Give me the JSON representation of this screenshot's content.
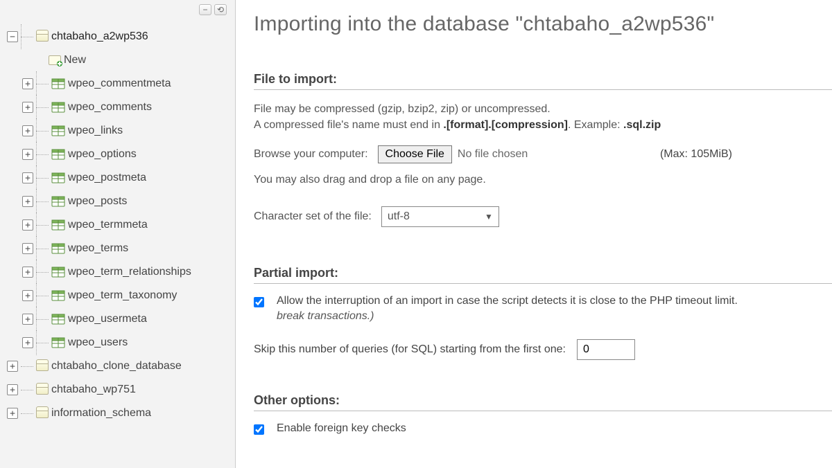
{
  "page": {
    "title_prefix": "Importing into the database ",
    "db_name_quoted": "\"chtabaho_a2wp536\""
  },
  "sidebar": {
    "selected_db": "chtabaho_a2wp536",
    "new_label": "New",
    "tables": [
      "wpeo_commentmeta",
      "wpeo_comments",
      "wpeo_links",
      "wpeo_options",
      "wpeo_postmeta",
      "wpeo_posts",
      "wpeo_termmeta",
      "wpeo_terms",
      "wpeo_term_relationships",
      "wpeo_term_taxonomy",
      "wpeo_usermeta",
      "wpeo_users"
    ],
    "other_dbs": [
      "chtabaho_clone_database",
      "chtabaho_wp751",
      "information_schema"
    ]
  },
  "file_section": {
    "heading": "File to import:",
    "desc_line1": "File may be compressed (gzip, bzip2, zip) or uncompressed.",
    "desc_line2_pre": "A compressed file's name must end in ",
    "desc_line2_fmt": ".[format].[compression]",
    "desc_line2_mid": ". Example: ",
    "desc_line2_ex": ".sql.zip",
    "browse_label": "Browse your computer:",
    "choose_btn": "Choose File",
    "no_file": "No file chosen",
    "max": "(Max: 105MiB)",
    "dragdrop": "You may also drag and drop a file on any page.",
    "charset_label": "Character set of the file:",
    "charset_value": "utf-8"
  },
  "partial_section": {
    "heading": "Partial import:",
    "allow_interrupt": "Allow the interruption of an import in case the script detects it is close to the PHP timeout limit.",
    "allow_interrupt_tail_italic": "break transactions.)",
    "allow_interrupt_checked": true,
    "skip_label": "Skip this number of queries (for SQL) starting from the first one:",
    "skip_value": "0"
  },
  "other_section": {
    "heading": "Other options:",
    "fk_label": "Enable foreign key checks",
    "fk_checked": true
  }
}
